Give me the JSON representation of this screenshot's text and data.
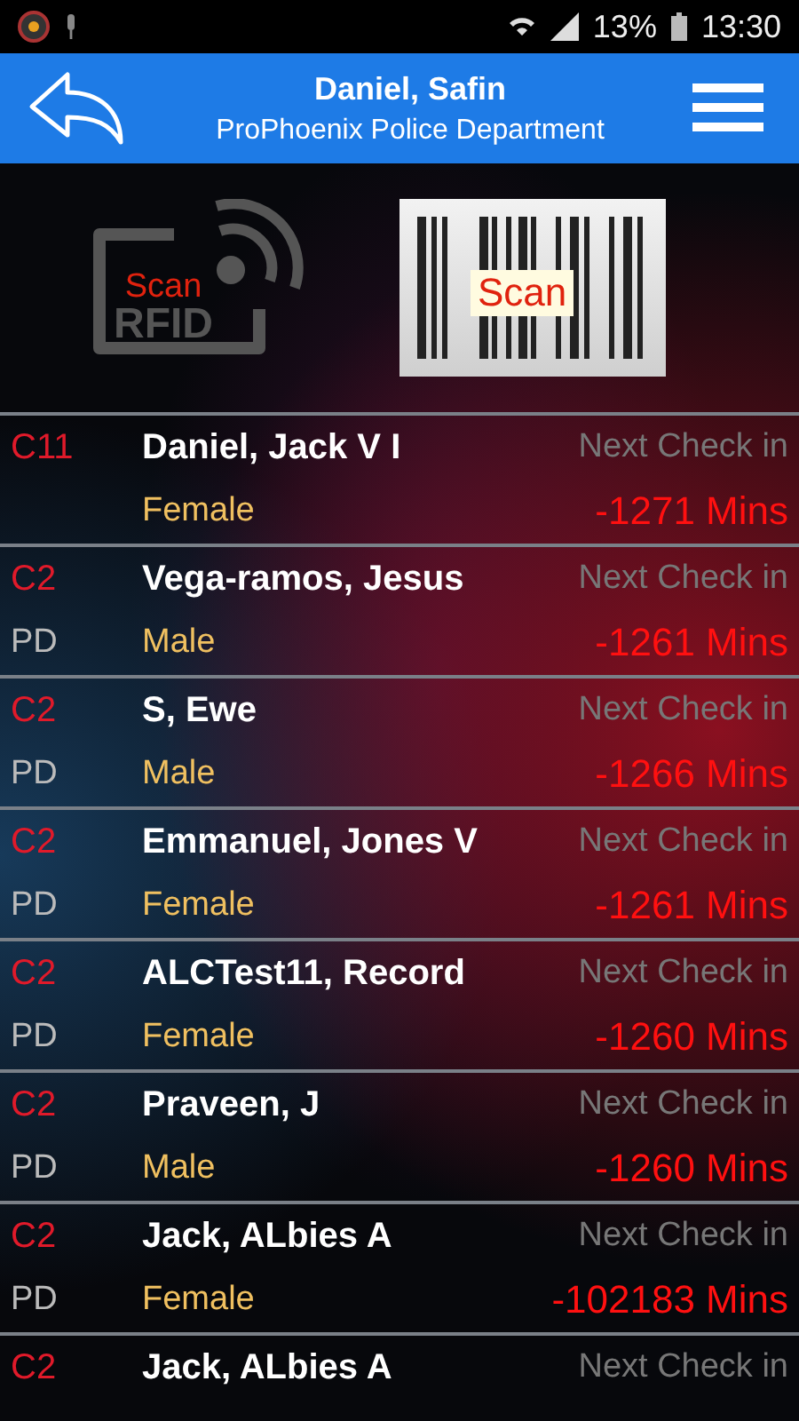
{
  "status_bar": {
    "battery": "13%",
    "time": "13:30"
  },
  "header": {
    "title": "Daniel, Safin",
    "subtitle": "ProPhoenix Police Department"
  },
  "scan_buttons": [
    {
      "kind": "rfid",
      "top": "Scan",
      "bottom": "RFID"
    },
    {
      "kind": "barcode",
      "top": "Scan"
    }
  ],
  "rows": [
    {
      "code": "C11",
      "name": "Daniel, Jack V I",
      "gender": "Female",
      "label": "Next Check in",
      "value": "-1271 Mins"
    },
    {
      "code": "C2",
      "agency": "PD",
      "name": "Vega-ramos, Jesus",
      "gender": "Male",
      "label": "Next Check in",
      "value": "-1261 Mins"
    },
    {
      "code": "C2",
      "agency": "PD",
      "name": "S, Ewe",
      "gender": "Male",
      "label": "Next Check in",
      "value": "-1266 Mins"
    },
    {
      "code": "C2",
      "agency": "PD",
      "name": "Emmanuel, Jones V",
      "gender": "Female",
      "label": "Next Check in",
      "value": "-1261 Mins"
    },
    {
      "code": "C2",
      "agency": "PD",
      "name": "ALCTest11, Record",
      "gender": "Female",
      "label": "Next Check in",
      "value": "-1260 Mins"
    },
    {
      "code": "C2",
      "agency": "PD",
      "name": "Praveen, J",
      "gender": "Male",
      "label": "Next Check in",
      "value": "-1260 Mins"
    },
    {
      "code": "C2",
      "agency": "PD",
      "name": "Jack, ALbies A",
      "gender": "Female",
      "label": "Next Check in",
      "value": "-102183 Mins"
    },
    {
      "code": "C2",
      "name": "Jack, ALbies A",
      "label": "Next Check in"
    }
  ]
}
